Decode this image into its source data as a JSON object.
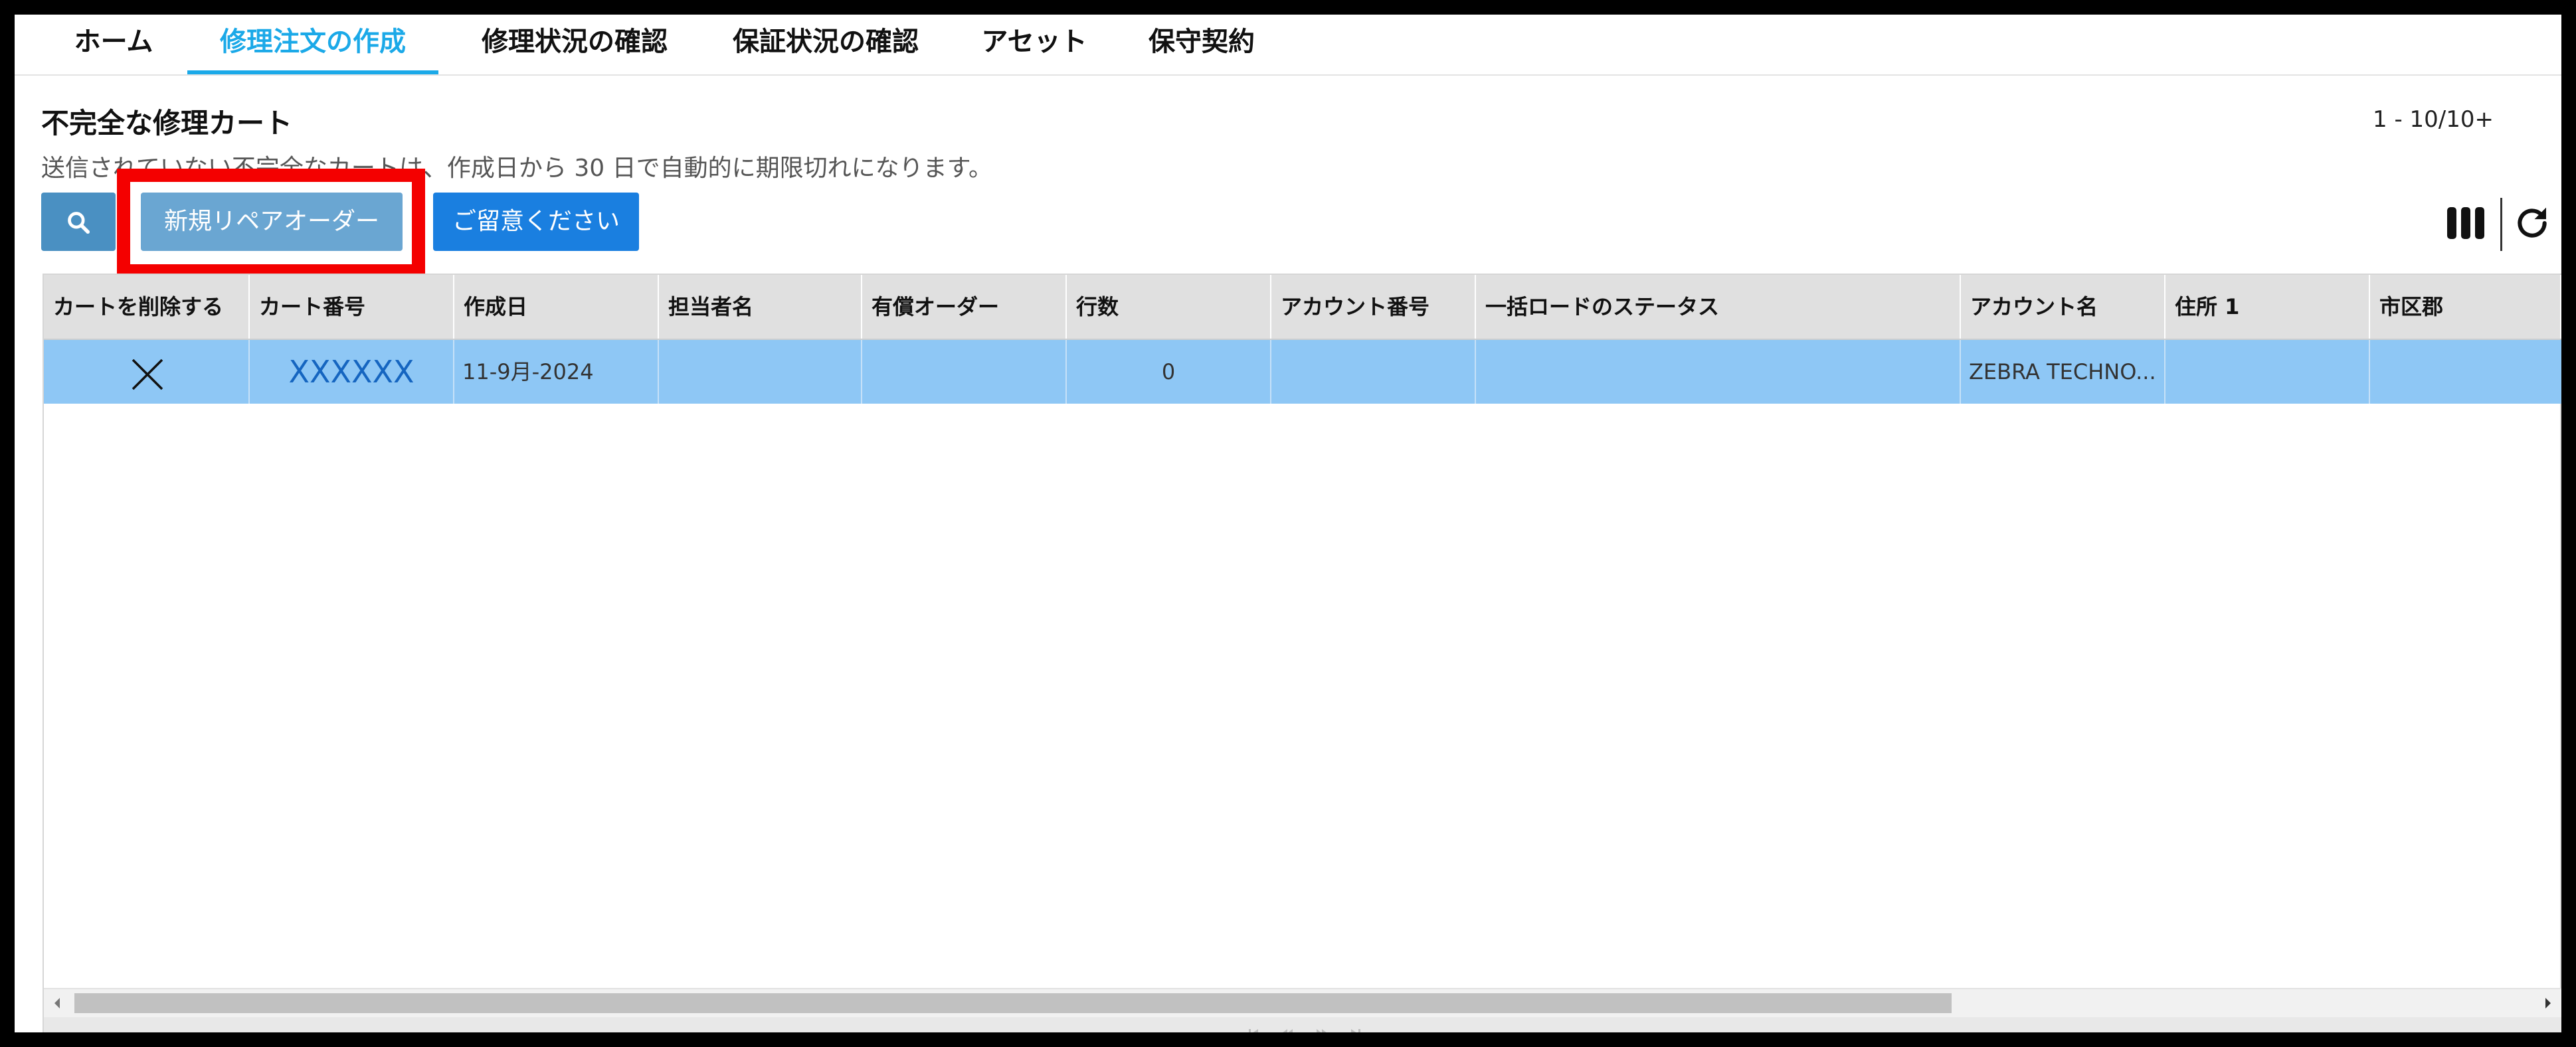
{
  "tabs": [
    {
      "label": "ホーム",
      "active": false
    },
    {
      "label": "修理注文の作成",
      "active": true
    },
    {
      "label": "修理状況の確認",
      "active": false
    },
    {
      "label": "保証状況の確認",
      "active": false
    },
    {
      "label": "アセット",
      "active": false
    },
    {
      "label": "保守契約",
      "active": false
    }
  ],
  "cart": {
    "title": "不完全な修理カート",
    "description": "送信されていない不完全なカートは、作成日から 30 日で自動的に期限切れになります。",
    "pager": "1 - 10/10+"
  },
  "toolbar": {
    "search_icon": "search-icon",
    "new_repair_label": "新規リペアオーダー",
    "notice_label": "ご留意ください",
    "columns_icon": "columns-icon",
    "refresh_icon": "refresh-icon"
  },
  "grid": {
    "columns": [
      "カートを削除する",
      "カート番号",
      "作成日",
      "担当者名",
      "有償オーダー",
      "行数",
      "アカウント番号",
      "一括ロードのステータス",
      "アカウント名",
      "住所 1",
      "市区郡"
    ],
    "rows": [
      {
        "delete_icon": "close-icon",
        "cart_number": "XXXXXX",
        "created_date": "11-9月-2024",
        "contact_name": "",
        "paid_order": "",
        "line_count": "0",
        "account_number": "",
        "bulk_status": "",
        "account_name": "ZEBRA TECHNO...",
        "address1": "",
        "city": ""
      }
    ]
  },
  "colors": {
    "accent": "#1ba9e8",
    "selected_row": "#8ec7f5",
    "highlight_box": "#f40000",
    "primary_button": "#1a7fe0"
  }
}
